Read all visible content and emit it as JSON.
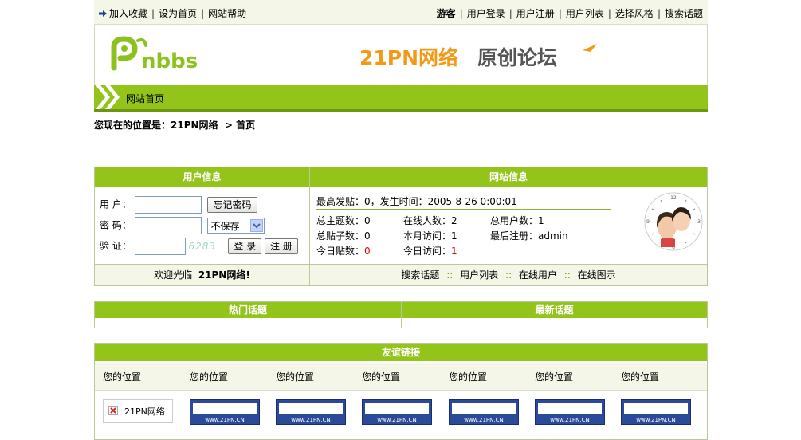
{
  "topbar": {
    "left_links": [
      "加入收藏",
      "设为首页",
      "网站帮助"
    ],
    "guest_label": "游客",
    "right_links": [
      "用户登录",
      "用户注册",
      "用户列表",
      "选择风格",
      "搜索话题"
    ]
  },
  "header": {
    "logo_text": "nbbs",
    "banner_main": "21PN网络",
    "banner_sub": "原创论坛"
  },
  "nav": {
    "home": "网站首页"
  },
  "breadcrumb": {
    "prefix": "您现在的位置是：21PN网络",
    "sep": ">",
    "current": "首页"
  },
  "user_panel": {
    "title": "用户信息",
    "user_label": "用 户：",
    "forgot_btn": "忘记密码",
    "pass_label": "密 码：",
    "remember_select": "不保存",
    "verify_label": "验 证：",
    "captcha": "6283",
    "login_btn": "登 录",
    "register_btn": "注 册",
    "welcome_prefix": "欢迎光临",
    "welcome_site": "21PN网络!"
  },
  "site_panel": {
    "title": "网站信息",
    "top_post": "最高发贴：0，发生时间：2005-8-26 0:00:01",
    "stats": {
      "topics_label": "总主题数：",
      "topics": "0",
      "online_label": "在线人数：",
      "online": "2",
      "users_label": "总用户数：",
      "users": "1",
      "posts_label": "总贴子数：",
      "posts": "0",
      "month_label": "本月访问：",
      "month": "1",
      "latest_label": "最后注册：",
      "latest": "admin",
      "today_posts_label": "今日贴数：",
      "today_posts": "0",
      "today_visits_label": "今日访问：",
      "today_visits": "1"
    },
    "footer_links": [
      "搜索话题",
      "用户列表",
      "在线用户",
      "在线图示"
    ],
    "footer_sep": "::"
  },
  "hot_topics": {
    "title": "热门话题"
  },
  "new_topics": {
    "title": "最新话题"
  },
  "friend_links": {
    "title": "友谊链接",
    "positions": [
      "您的位置",
      "您的位置",
      "您的位置",
      "您的位置",
      "您的位置",
      "您的位置",
      "您的位置"
    ],
    "first_link": "21PN网络",
    "banner_text": "www.21PN.CN"
  },
  "colors": {
    "accent": "#93c41a",
    "red": "#e00000"
  }
}
